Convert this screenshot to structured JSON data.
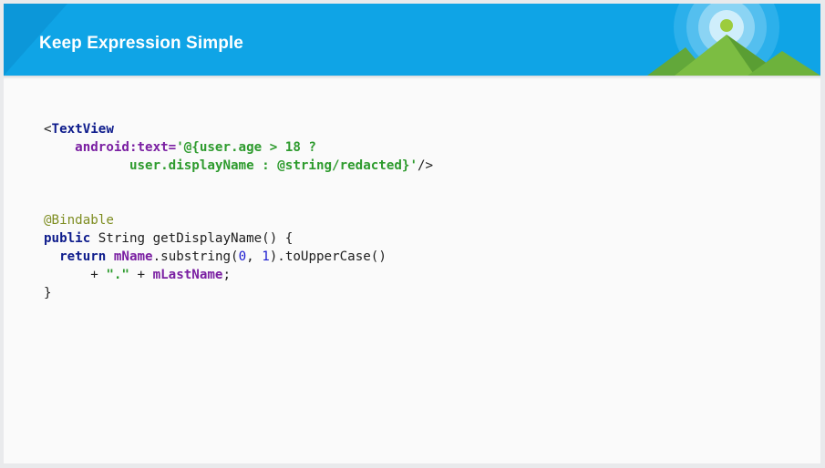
{
  "slide": {
    "title": "Keep Expression Simple"
  },
  "code": {
    "xml": {
      "tag_open": "<",
      "tag_name": "TextView",
      "attr_name": "android:text=",
      "value_line1": "'@{user.age > 18 ?",
      "value_line2": "user.displayName : @string/redacted}'",
      "tag_close": "/>"
    },
    "java": {
      "annotation": "@Bindable",
      "kw_public": "public",
      "signature": " String getDisplayName() {",
      "kw_return": "return",
      "field_name": "mName",
      "call": ".substring(",
      "arg0": "0",
      "comma": ", ",
      "arg1": "1",
      "call_end": ").toUpperCase()",
      "plus1": "+ ",
      "dot_string": "\".\"",
      "plus2": " + ",
      "field_lastname": "mLastName",
      "semicolon": ";",
      "closing_brace": "}"
    }
  }
}
